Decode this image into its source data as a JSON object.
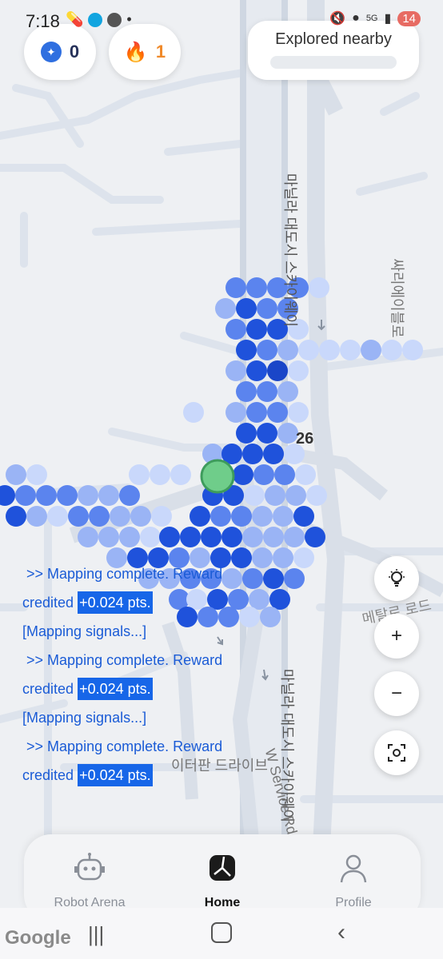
{
  "status_bar": {
    "time": "7:18",
    "battery_badge": "14",
    "network": "5G"
  },
  "header": {
    "points_value": "0",
    "streak_value": "1",
    "explored_label": "Explored nearby"
  },
  "map": {
    "road_labels": {
      "road_a": "마닐라 대도시 스카이웨이",
      "road_b": "마닐라 대도시 스카이웨이",
      "service_road": "W Service Rd",
      "side_street": "싸리에이블로",
      "bottom_street": "이터판 드라이브",
      "right_road": "메탈로 로드",
      "number": "26"
    },
    "brand": "Google",
    "hex_colors": [
      "#1f52db",
      "#5b84ee",
      "#9ab4f5",
      "#c9d8fb",
      "#1a46c8"
    ]
  },
  "log": {
    "entries": [
      {
        "text": ">> Mapping complete. Reward credited",
        "reward": "+0.024 pts."
      },
      {
        "text": "[Mapping signals...]"
      },
      {
        "text": ">> Mapping complete. Reward credited",
        "reward": "+0.024 pts."
      },
      {
        "text": "[Mapping signals...]"
      },
      {
        "text": ">> Mapping complete. Reward credited",
        "reward": "+0.024 pts."
      }
    ],
    "line1": ">> Mapping complete. Reward",
    "line2": "credited",
    "line3": "+0.024 pts.",
    "line4": "[Mapping signals...]",
    "line5": ">> Mapping complete. Reward",
    "line6": "credited",
    "line7": "+0.024 pts.",
    "line8": "[Mapping signals...]",
    "line9": ">> Mapping complete. Reward",
    "line10": "credited",
    "line11": "+0.024 pts."
  },
  "controls": {
    "hint_icon": "lightbulb-icon",
    "zoom_in": "+",
    "zoom_out": "−",
    "recenter_icon": "crosshair-icon"
  },
  "bottom_nav": {
    "items": [
      {
        "label": "Robot Arena",
        "icon": "robot-icon"
      },
      {
        "label": "Home",
        "icon": "home-map-icon"
      },
      {
        "label": "Profile",
        "icon": "person-icon"
      }
    ]
  }
}
